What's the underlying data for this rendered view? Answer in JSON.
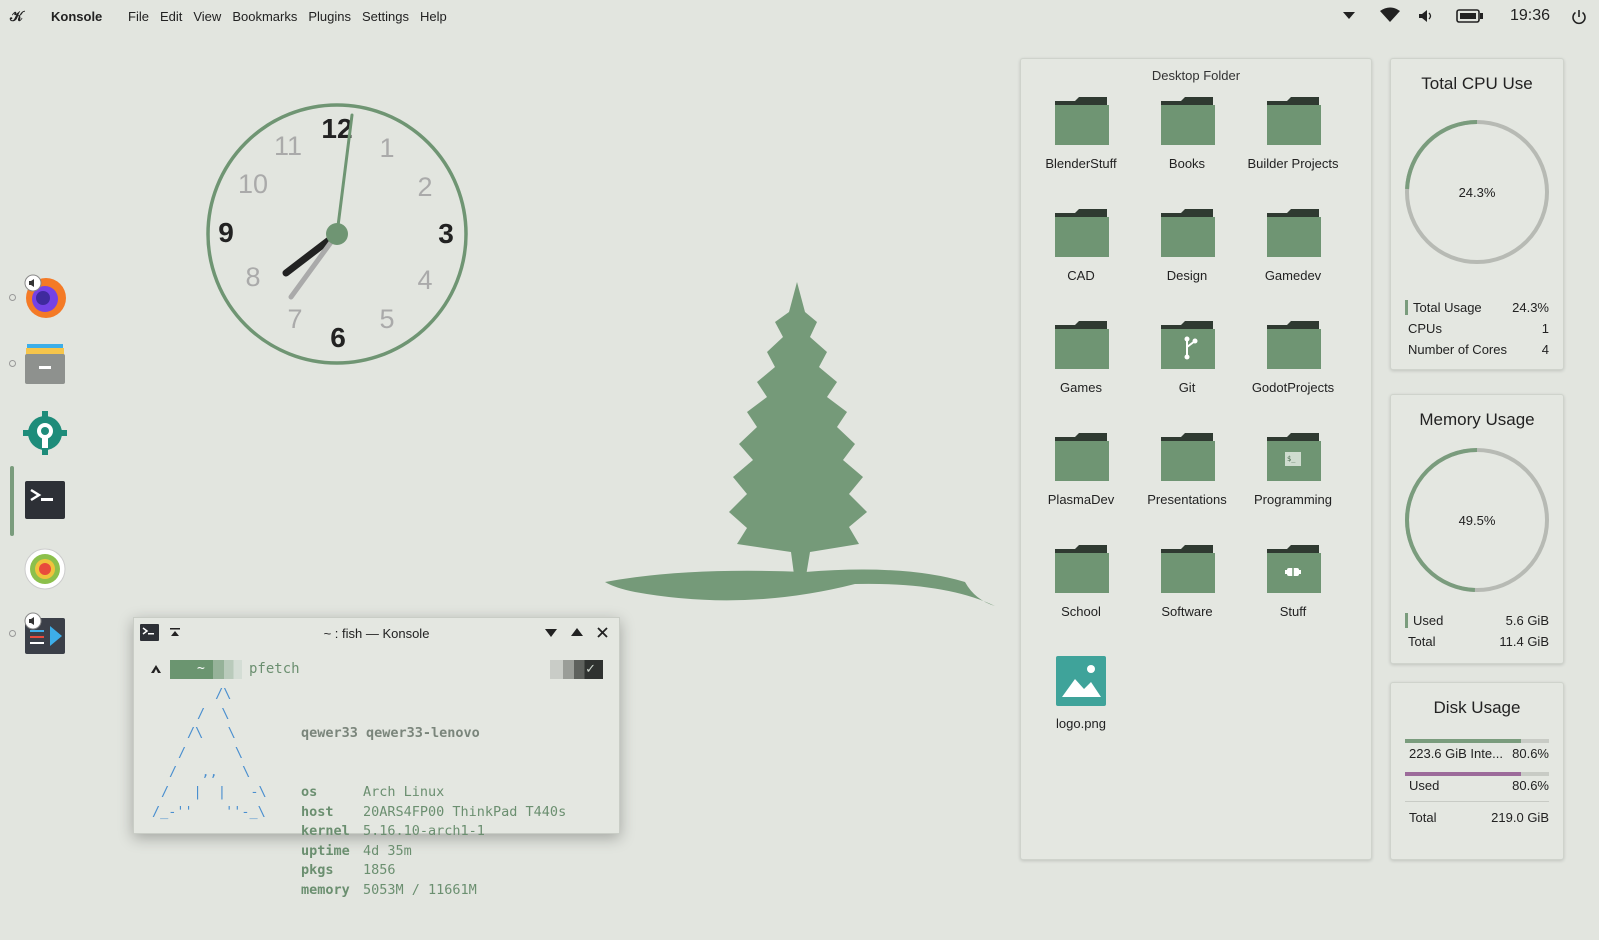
{
  "topbar": {
    "app_name": "Konsole",
    "menu": [
      "File",
      "Edit",
      "View",
      "Bookmarks",
      "Plugins",
      "Settings",
      "Help"
    ],
    "clock": "19:36",
    "tray_icons": [
      "chevron-down-icon",
      "wifi-icon",
      "volume-icon",
      "battery-icon",
      "power-icon"
    ]
  },
  "dock": {
    "items": [
      "firefox",
      "files",
      "system-settings",
      "konsole",
      "disk-usage",
      "video-editor"
    ]
  },
  "analog_clock": {
    "time": "19:36",
    "numerals": [
      "12",
      "1",
      "2",
      "3",
      "4",
      "5",
      "6",
      "7",
      "8",
      "9",
      "10",
      "11"
    ]
  },
  "desktop_folder": {
    "title": "Desktop Folder",
    "items": [
      {
        "label": "BlenderStuff",
        "icon": "folder-icon"
      },
      {
        "label": "Books",
        "icon": "folder-icon"
      },
      {
        "label": "Builder Projects",
        "icon": "folder-icon"
      },
      {
        "label": "CAD",
        "icon": "folder-icon"
      },
      {
        "label": "Design",
        "icon": "folder-icon"
      },
      {
        "label": "Gamedev",
        "icon": "folder-icon"
      },
      {
        "label": "Games",
        "icon": "folder-icon"
      },
      {
        "label": "Git",
        "icon": "folder-git-icon"
      },
      {
        "label": "GodotProjects",
        "icon": "folder-icon"
      },
      {
        "label": "PlasmaDev",
        "icon": "folder-icon"
      },
      {
        "label": "Presentations",
        "icon": "folder-icon"
      },
      {
        "label": "Programming",
        "icon": "folder-script-icon"
      },
      {
        "label": "School",
        "icon": "folder-icon"
      },
      {
        "label": "Software",
        "icon": "folder-icon"
      },
      {
        "label": "Stuff",
        "icon": "folder-stuff-icon"
      },
      {
        "label": "logo.png",
        "icon": "image-file-icon"
      }
    ]
  },
  "cpu": {
    "title": "Total CPU Use",
    "percent_label": "24.3%",
    "percent": 24.3,
    "rows": [
      {
        "label": "Total Usage",
        "value": "24.3%"
      },
      {
        "label": "CPUs",
        "value": "1"
      },
      {
        "label": "Number of Cores",
        "value": "4"
      }
    ]
  },
  "memory": {
    "title": "Memory Usage",
    "percent_label": "49.5%",
    "percent": 49.5,
    "rows": [
      {
        "label": "Used",
        "value": "5.6 GiB"
      },
      {
        "label": "Total",
        "value": "11.4 GiB"
      }
    ]
  },
  "disk": {
    "title": "Disk Usage",
    "drive_label": "223.6 GiB Inte...",
    "drive_percent": "80.6%",
    "drive_fill": 80.6,
    "used_label": "Used",
    "used_percent": "80.6%",
    "used_fill": 80.6,
    "total_label": "Total",
    "total_value": "219.0 GiB"
  },
  "konsole": {
    "title": "~ : fish — Konsole",
    "prompt_dir": "~",
    "command": "pfetch",
    "status_icon": "check-icon",
    "user_host": "qewer33 qewer33-lenovo",
    "ascii": [
      " /\\",
      "/  \\",
      "/\\   \\",
      "/      \\",
      "/   ,,   \\",
      "/   |  |   -\\",
      "/_-''    ''-_\\"
    ],
    "info": [
      {
        "key": "os",
        "value": "Arch Linux"
      },
      {
        "key": "host",
        "value": "20ARS4FP00 ThinkPad T440s"
      },
      {
        "key": "kernel",
        "value": "5.16.10-arch1-1"
      },
      {
        "key": "uptime",
        "value": "4d 35m"
      },
      {
        "key": "pkgs",
        "value": "1856"
      },
      {
        "key": "memory",
        "value": "5053M / 11661M"
      }
    ]
  },
  "colors": {
    "accent": "#7a9c7d",
    "background": "#e2e5df",
    "folder": "#6f9573"
  }
}
